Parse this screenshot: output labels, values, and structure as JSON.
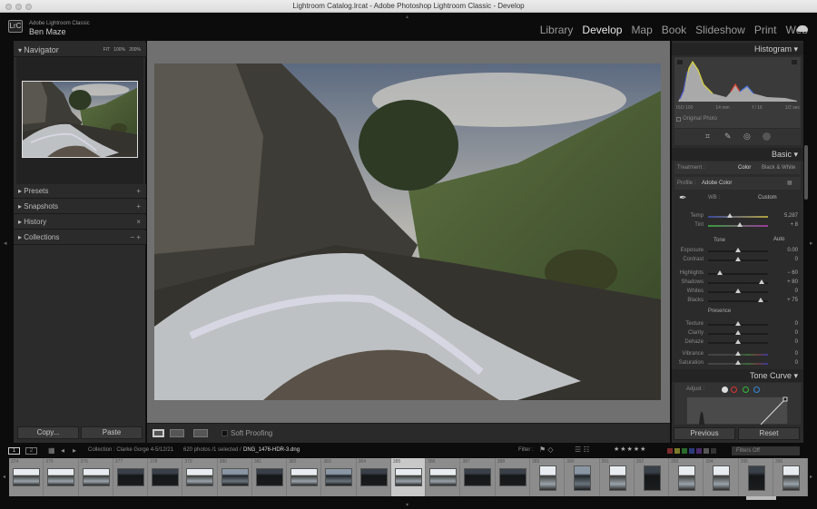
{
  "window": {
    "title": "Lightroom Catalog.lrcat - Adobe Photoshop Lightroom Classic - Develop"
  },
  "identity": {
    "app": "Adobe Lightroom Classic",
    "user": "Ben Maze",
    "logo": "LrC"
  },
  "modules": [
    {
      "label": "Library"
    },
    {
      "label": "Develop",
      "active": true
    },
    {
      "label": "Map"
    },
    {
      "label": "Book"
    },
    {
      "label": "Slideshow"
    },
    {
      "label": "Print"
    },
    {
      "label": "Web"
    }
  ],
  "left": {
    "navigator": {
      "title": "Navigator",
      "zoom": [
        "FIT",
        "100%",
        "200%"
      ]
    },
    "panels": [
      {
        "label": "Presets",
        "action": "+"
      },
      {
        "label": "Snapshots",
        "action": "+"
      },
      {
        "label": "History",
        "action": "×"
      },
      {
        "label": "Collections",
        "action": "− +"
      }
    ],
    "copy": "Copy...",
    "paste": "Paste"
  },
  "toolbar": {
    "soft_proofing": "Soft Proofing"
  },
  "right": {
    "histogram": {
      "title": "Histogram",
      "iso": "ISO 100",
      "focal": "14 mm",
      "aperture": "f / 16",
      "shutter": "1/2 sec",
      "original": "Original Photo"
    },
    "basic": {
      "title": "Basic",
      "treatment_label": "Treatment :",
      "color": "Color",
      "bw": "Black & White",
      "profile_label": "Profile :",
      "profile": "Adobe Color",
      "wb_label": "WB :",
      "wb": "Custom",
      "tone": "Tone",
      "auto": "Auto",
      "presence": "Presence"
    },
    "sliders": [
      {
        "label": "Temp",
        "value": "5,287",
        "fraction": 0.37,
        "kind": "temp"
      },
      {
        "label": "Tint",
        "value": "+ 8",
        "fraction": 0.53,
        "kind": "tint"
      },
      {
        "label": "Exposure",
        "value": "0.00",
        "fraction": 0.5
      },
      {
        "label": "Contrast",
        "value": "0",
        "fraction": 0.5
      },
      {
        "label": "Highlights",
        "value": "− 60",
        "fraction": 0.2
      },
      {
        "label": "Shadows",
        "value": "+ 80",
        "fraction": 0.9
      },
      {
        "label": "Whites",
        "value": "0",
        "fraction": 0.5
      },
      {
        "label": "Blacks",
        "value": "+ 75",
        "fraction": 0.875
      },
      {
        "label": "Texture",
        "value": "0",
        "fraction": 0.5
      },
      {
        "label": "Clarity",
        "value": "0",
        "fraction": 0.5
      },
      {
        "label": "Dehaze",
        "value": "0",
        "fraction": 0.5
      },
      {
        "label": "Vibrance",
        "value": "0",
        "fraction": 0.5,
        "kind": "color"
      },
      {
        "label": "Saturation",
        "value": "0",
        "fraction": 0.5,
        "kind": "color"
      }
    ],
    "tone_curve": {
      "title": "Tone Curve",
      "adjust": "Adjust :"
    },
    "previous": "Previous",
    "reset": "Reset"
  },
  "filmstrip": {
    "pages": [
      "1",
      "2"
    ],
    "collection": "Collection : Clarke Gorge 4-5/12/21",
    "count": "620 photos /1 selected /",
    "file": "DNG_1476-HDR-3.dng",
    "filter_label": "Filter :",
    "filter_value": "Filters Off",
    "label_colors": [
      "#7a2a2a",
      "#7a7a2a",
      "#2a6a2a",
      "#2a3a7a",
      "#4a2a6a",
      "#555555",
      "#333333"
    ],
    "thumbs": [
      {
        "n": "374",
        "tone": "light"
      },
      {
        "n": "375",
        "tone": "light"
      },
      {
        "n": "376",
        "tone": "light"
      },
      {
        "n": "377",
        "tone": "dark"
      },
      {
        "n": "378",
        "tone": "dark"
      },
      {
        "n": "379",
        "tone": "light"
      },
      {
        "n": "380",
        "tone": "mid"
      },
      {
        "n": "381",
        "tone": "dark"
      },
      {
        "n": "382",
        "tone": "light"
      },
      {
        "n": "383",
        "tone": "mid"
      },
      {
        "n": "384",
        "tone": "dark"
      },
      {
        "n": "385",
        "tone": "light",
        "selected": true
      },
      {
        "n": "386",
        "tone": "light"
      },
      {
        "n": "387",
        "tone": "dark"
      },
      {
        "n": "388",
        "tone": "dark"
      },
      {
        "n": "389",
        "tone": "light",
        "portrait": true
      },
      {
        "n": "390",
        "tone": "mid",
        "portrait": true
      },
      {
        "n": "391",
        "tone": "light",
        "portrait": true
      },
      {
        "n": "392",
        "tone": "dark",
        "portrait": true
      },
      {
        "n": "393",
        "tone": "light",
        "portrait": true
      },
      {
        "n": "394",
        "tone": "light",
        "portrait": true
      },
      {
        "n": "395",
        "tone": "dark",
        "portrait": true
      },
      {
        "n": "396",
        "tone": "light",
        "portrait": true
      }
    ]
  }
}
